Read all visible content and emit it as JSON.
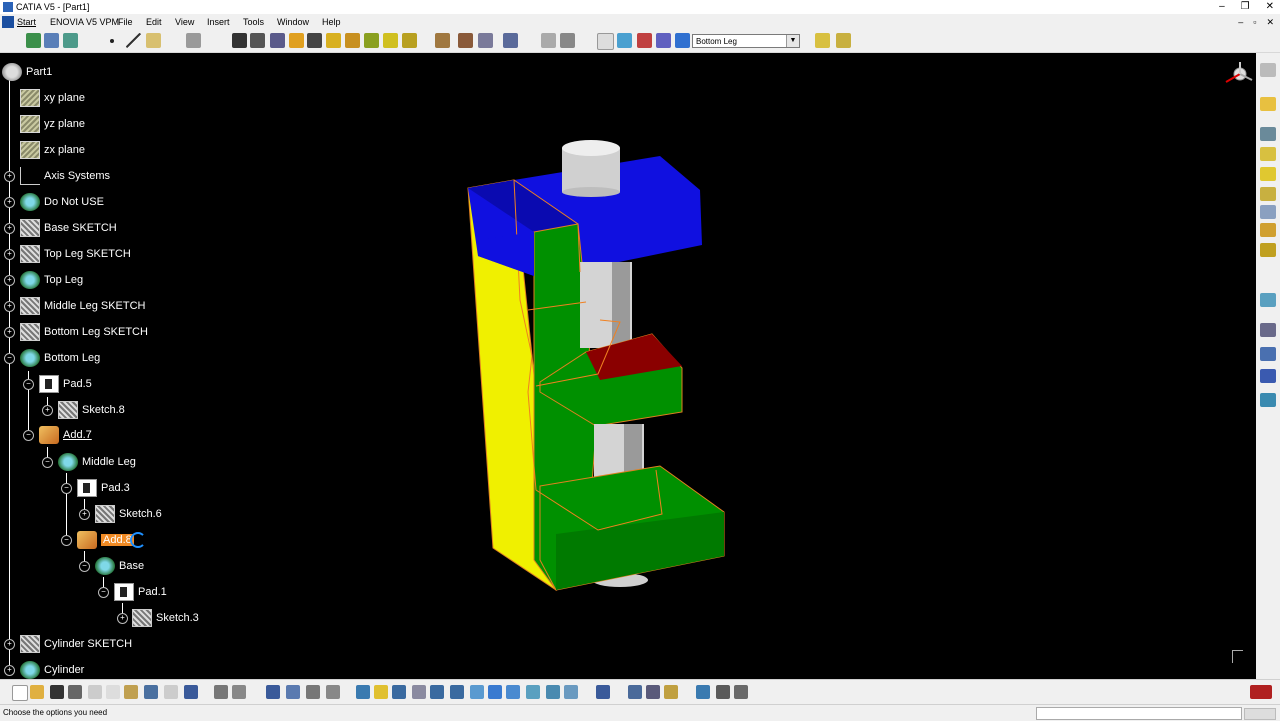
{
  "window": {
    "title": "CATIA V5 - [Part1]",
    "buttons": [
      "–",
      "❐",
      "✕"
    ]
  },
  "menu": {
    "items": [
      "Start",
      "ENOVIA V5 VPM",
      "File",
      "Edit",
      "View",
      "Insert",
      "Tools",
      "Window",
      "Help"
    ],
    "mdi_buttons": [
      "–",
      "▫",
      "✕"
    ]
  },
  "toolbar": {
    "body_combo_value": "Bottom Leg"
  },
  "tree": {
    "root": "Part1",
    "nodes": [
      "xy plane",
      "yz plane",
      "zx plane",
      "Axis Systems",
      "Do Not USE",
      "Base SKETCH",
      "Top Leg SKETCH",
      "Top Leg",
      "Middle Leg SKETCH",
      "Bottom Leg SKETCH",
      "Bottom Leg",
      "Pad.5",
      "Sketch.8",
      "Add.7",
      "Middle Leg",
      "Pad.3",
      "Sketch.6",
      "Add.8",
      "Base",
      "Pad.1",
      "Sketch.3",
      "Cylinder SKETCH",
      "Cylinder"
    ]
  },
  "status": {
    "message": "Choose the options you need"
  },
  "colors": {
    "background": "#000000",
    "top_leg": "#1010e0",
    "yellow_body": "#f0f000",
    "green_body": "#009000",
    "cylinder": "#d8d8d8",
    "selection_highlight": "#f08a24"
  },
  "icons": [
    "app-icon",
    "compass-icon",
    "cursor-icon",
    "catia-logo-icon"
  ]
}
